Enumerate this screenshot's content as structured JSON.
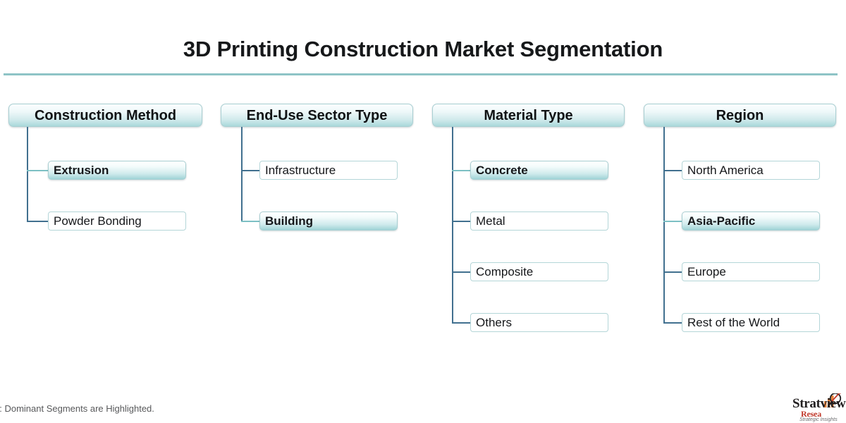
{
  "title": "3D Printing Construction Market Segmentation",
  "footnote": "e: Dominant Segments are Highlighted.",
  "colors": {
    "accent_teal": "#8ec4c6",
    "trunk_blue": "#41708f",
    "branch_teal": "#7dc0c4",
    "box_border": "#b4d6d8",
    "highlight_fill": "#9fd3d6",
    "text": "#15171a",
    "background": "#ffffff"
  },
  "logo": {
    "name": "Stratview",
    "subtitle": "Resea",
    "tagline": "Strategic Insights ",
    "mark": "magnifier-bar-chart-icon"
  },
  "columns": [
    {
      "id": "construction-method",
      "header": "Construction Method",
      "items": [
        {
          "label": "Extrusion",
          "highlighted": true
        },
        {
          "label": "Powder Bonding",
          "highlighted": false
        }
      ]
    },
    {
      "id": "end-use-sector-type",
      "header": "End-Use Sector Type",
      "items": [
        {
          "label": "Infrastructure",
          "highlighted": false
        },
        {
          "label": "Building",
          "highlighted": true
        }
      ]
    },
    {
      "id": "material-type",
      "header": "Material Type",
      "items": [
        {
          "label": "Concrete",
          "highlighted": true
        },
        {
          "label": "Metal",
          "highlighted": false
        },
        {
          "label": "Composite",
          "highlighted": false
        },
        {
          "label": "Others",
          "highlighted": false
        }
      ]
    },
    {
      "id": "region",
      "header": "Region",
      "items": [
        {
          "label": "North America",
          "highlighted": false
        },
        {
          "label": "Asia-Pacific",
          "highlighted": true
        },
        {
          "label": "Europe",
          "highlighted": false
        },
        {
          "label": "Rest of the World",
          "highlighted": false
        }
      ]
    }
  ]
}
